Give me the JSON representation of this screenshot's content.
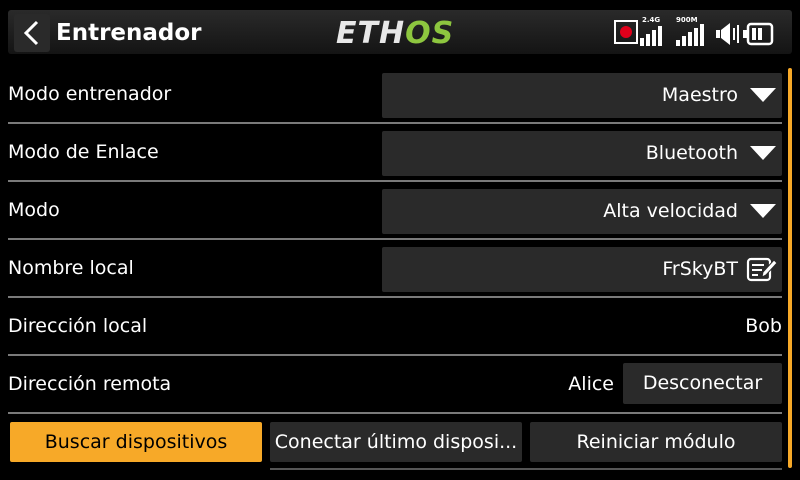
{
  "header": {
    "title": "Entrenador",
    "logo_left": "ETH",
    "logo_right": "OS",
    "back_icon": "chevron-left-icon",
    "status": {
      "rssi_24_label": "2.4G",
      "rssi_900_label": "900M",
      "icons": [
        "record-icon",
        "signal-24g-icon",
        "signal-900m-icon",
        "volume-icon",
        "battery-icon"
      ],
      "record_color": "#e0001b"
    }
  },
  "rows": [
    {
      "label": "Modo entrenador",
      "value": "Maestro"
    },
    {
      "label": "Modo de Enlace",
      "value": "Bluetooth"
    },
    {
      "label": "Modo",
      "value": "Alta velocidad"
    },
    {
      "label": "Nombre local",
      "value": "FrSkyBT"
    },
    {
      "label": "Dirección local",
      "value": "Bob"
    },
    {
      "label": "Dirección remota",
      "value": "Alice",
      "button": "Desconectar"
    }
  ],
  "buttons": {
    "scan": "Buscar dispositivos",
    "connect_last": "Conectar último disposi...",
    "reset": "Reiniciar módulo"
  },
  "colors": {
    "accent": "#f7a928",
    "control_bg": "#2a2a2a",
    "separator": "#7a7a7a",
    "logo_green": "#8dc63f"
  }
}
